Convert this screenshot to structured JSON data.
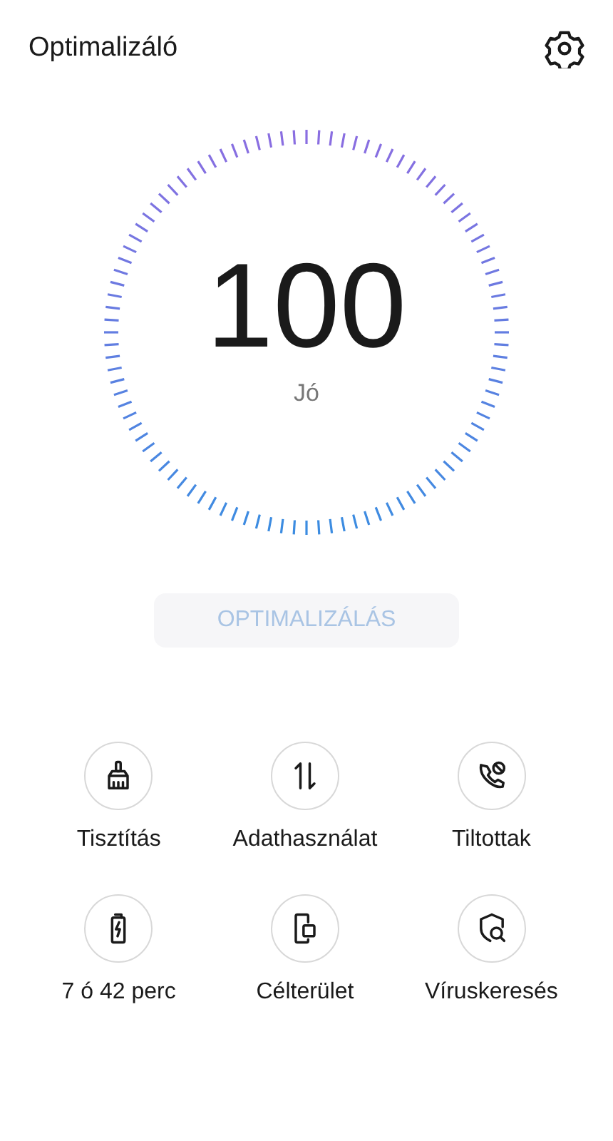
{
  "header": {
    "title": "Optimalizáló"
  },
  "score": {
    "value": "100",
    "status": "Jó"
  },
  "optimize_button": {
    "label": "OPTIMALIZÁLÁS",
    "disabled": true
  },
  "tools": [
    {
      "kind": "broom",
      "label": "Tisztítás"
    },
    {
      "kind": "transfer",
      "label": "Adathasználat"
    },
    {
      "kind": "call-block",
      "label": "Tiltottak"
    },
    {
      "kind": "battery",
      "label": "7 ó 42 perc"
    },
    {
      "kind": "phone-window",
      "label": "Célterület"
    },
    {
      "kind": "shield-search",
      "label": "Víruskeresés"
    }
  ]
}
